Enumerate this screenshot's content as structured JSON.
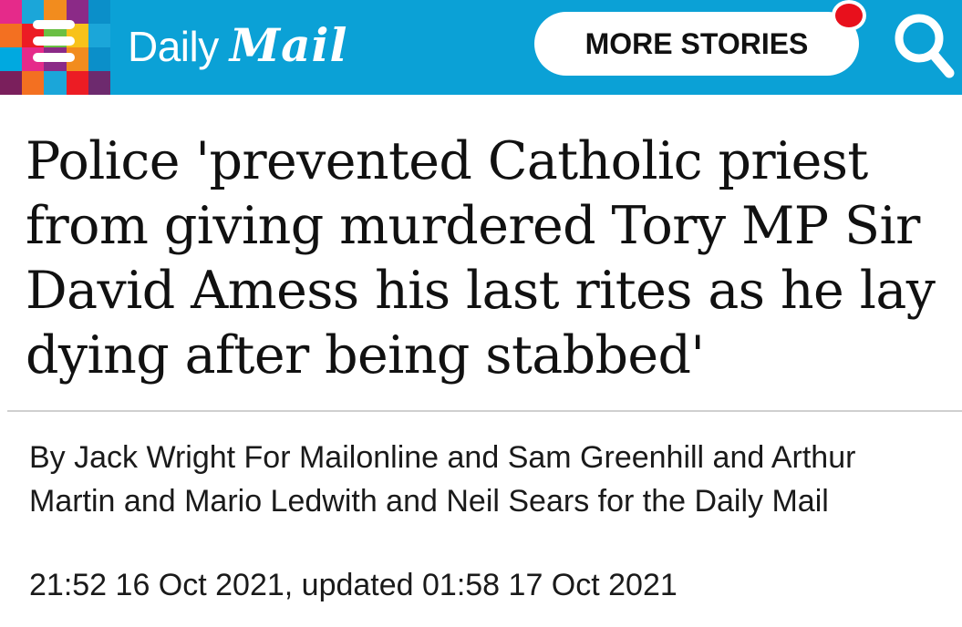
{
  "header": {
    "logo_daily": "Daily",
    "logo_mail": "Mail",
    "more_stories_label": "MORE STORIES",
    "icons": {
      "menu": "hamburger-menu-icon",
      "search": "search-icon",
      "notification": "notification-dot-icon"
    },
    "colors": {
      "bar": "#0ba1d6",
      "notification_dot": "#e8101c",
      "mosaic": [
        "#e52a8a",
        "#1ba6d9",
        "#f28c1e",
        "#8b2a87",
        "#0b8fc9",
        "#f37021",
        "#ec1c24",
        "#6bbf44",
        "#f8c21b",
        "#1ba6d9",
        "#00a9e0",
        "#e52a8a",
        "#8b2a87",
        "#f28c1e",
        "#0b8fc9",
        "#7a1f5c",
        "#f37021",
        "#1ba6d9",
        "#ec1c24",
        "#6d2a6e"
      ]
    }
  },
  "article": {
    "headline": "Police 'prevented Catholic priest from giving murdered Tory MP Sir David Amess his last rites as he lay dying after being stabbed'",
    "byline": "By Jack Wright For Mailonline and Sam Greenhill and Arthur Martin and Mario Ledwith and Neil Sears for the Daily Mail",
    "timestamp": "21:52 16 Oct 2021, updated 01:58 17 Oct 2021"
  }
}
